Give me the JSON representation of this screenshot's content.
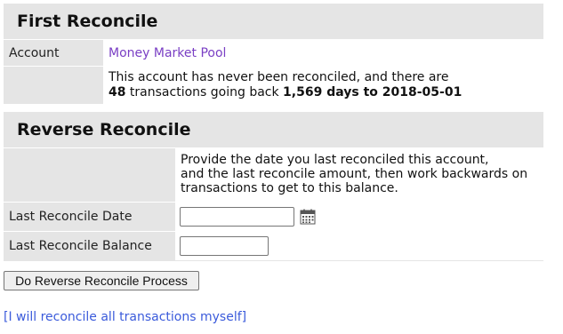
{
  "first_reconcile": {
    "title": "First Reconcile",
    "account_label": "Account",
    "account_value": "Money Market Pool",
    "message_line1": "This account has never been reconciled, and there are",
    "message_count": "48",
    "message_mid": " transactions going back ",
    "message_span": "1,569 days to 2018-05-01"
  },
  "reverse_reconcile": {
    "title": "Reverse Reconcile",
    "instructions": [
      "Provide the date you last reconciled this account,",
      "and the last reconcile amount, then work backwards on",
      "transactions to get to this balance."
    ],
    "last_date_label": "Last Reconcile Date",
    "last_date_value": "",
    "last_balance_label": "Last Reconcile Balance",
    "last_balance_value": "",
    "calendar_icon": "calendar-icon"
  },
  "actions": {
    "process_button": "Do Reverse Reconcile Process",
    "self_link": "[I will reconcile all transactions myself]"
  },
  "colors": {
    "panel_bg": "#e5e5e5",
    "account_link": "#7a3fc4",
    "bottom_link": "#3b5bdb"
  }
}
